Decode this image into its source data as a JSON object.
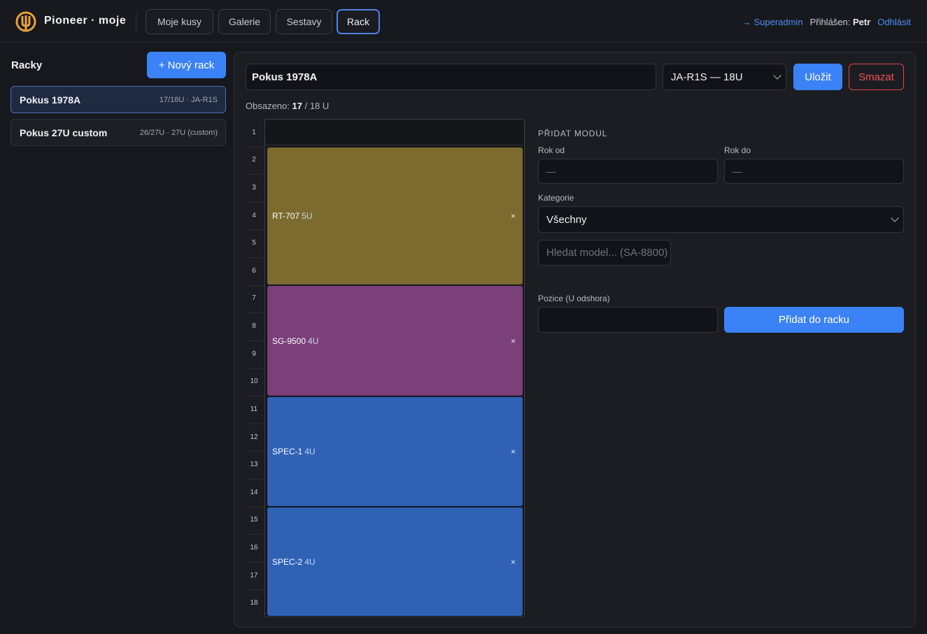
{
  "app": {
    "brand": "Pioneer · moje",
    "nav": [
      {
        "label": "Moje kusy",
        "active": false
      },
      {
        "label": "Galerie",
        "active": false
      },
      {
        "label": "Sestavy",
        "active": false
      },
      {
        "label": "Rack",
        "active": true
      }
    ],
    "superadmin_link": "→ Superadmin",
    "logged_in_label": "Přihlášen:",
    "user_name": "Petr",
    "logout_link": "Odhlásit"
  },
  "sidebar": {
    "title": "Racky",
    "new_button": "+ Nový rack",
    "racks": [
      {
        "name": "Pokus 1978A",
        "meta": "17/18U · JA-R1S",
        "active": true
      },
      {
        "name": "Pokus 27U custom",
        "meta": "26/27U · 27U (custom)",
        "active": false
      }
    ]
  },
  "editor": {
    "rack_name_value": "Pokus 1978A",
    "rack_type_value": "JA-R1S — 18U",
    "save_button": "Uložit",
    "delete_button": "Smazat",
    "occupancy_label": "Obsazeno:",
    "occupancy_used": "17",
    "occupancy_total": "/ 18 U"
  },
  "rack": {
    "units": [
      "1",
      "2",
      "3",
      "4",
      "5",
      "6",
      "7",
      "8",
      "9",
      "10",
      "11",
      "12",
      "13",
      "14",
      "15",
      "16",
      "17",
      "18"
    ],
    "modules": [
      {
        "name": "RT-707",
        "size": "5U",
        "color": "#7d6a2f",
        "remove": "×"
      },
      {
        "name": "SG-9500",
        "size": "4U",
        "color": "#7b3f7a",
        "remove": "×"
      },
      {
        "name": "SPEC-1",
        "size": "4U",
        "color": "#2f61b5",
        "remove": "×"
      },
      {
        "name": "SPEC-2",
        "size": "4U",
        "color": "#2f61b5",
        "remove": "×"
      }
    ]
  },
  "add_module": {
    "title": "PŘIDAT MODUL",
    "year_from_label": "Rok od",
    "year_from_placeholder": "—",
    "year_to_label": "Rok do",
    "year_to_placeholder": "—",
    "category_label": "Kategorie",
    "category_value": "Všechny",
    "search_placeholder": "Hledat model... (SA-8800)",
    "position_label": "Pozice (U odshora)",
    "position_value": "",
    "add_button": "Přidat do racku"
  },
  "colors": {
    "accent": "#3b82f6",
    "danger": "#e04747",
    "background": "#16181d"
  }
}
